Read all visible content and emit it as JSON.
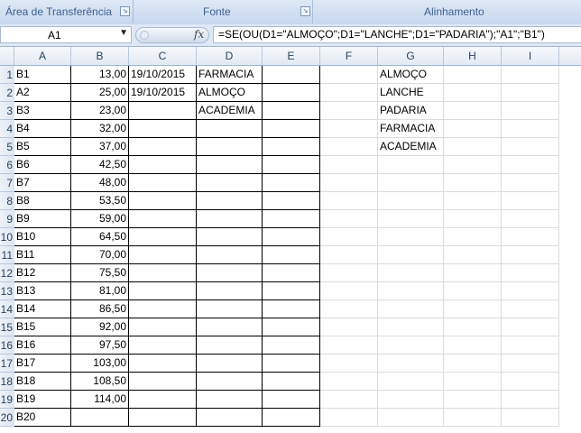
{
  "ribbon": {
    "groups": [
      {
        "label": "Área de Transferência"
      },
      {
        "label": "Fonte"
      },
      {
        "label": "Alinhamento"
      }
    ]
  },
  "formula_bar": {
    "name_box": "A1",
    "fx_icon": "function-icon",
    "formula": "=SE(OU(D1=\"ALMOÇO\";D1=\"LANCHE\";D1=\"PADARIA\");\"A1\";\"B1\")"
  },
  "columns": [
    "A",
    "B",
    "C",
    "D",
    "E",
    "F",
    "G",
    "H",
    "I"
  ],
  "rows": [
    {
      "n": "1",
      "A": "B1",
      "B": "13,00",
      "C": "19/10/2015",
      "D": "FARMACIA",
      "G": "ALMOÇO"
    },
    {
      "n": "2",
      "A": "A2",
      "B": "25,00",
      "C": "19/10/2015",
      "D": "ALMOÇO",
      "G": "LANCHE"
    },
    {
      "n": "3",
      "A": "B3",
      "B": "23,00",
      "C": "",
      "D": "ACADEMIA",
      "G": "PADARIA"
    },
    {
      "n": "4",
      "A": "B4",
      "B": "32,00",
      "C": "",
      "D": "",
      "G": "FARMACIA"
    },
    {
      "n": "5",
      "A": "B5",
      "B": "37,00",
      "C": "",
      "D": "",
      "G": "ACADEMIA"
    },
    {
      "n": "6",
      "A": "B6",
      "B": "42,50"
    },
    {
      "n": "7",
      "A": "B7",
      "B": "48,00"
    },
    {
      "n": "8",
      "A": "B8",
      "B": "53,50"
    },
    {
      "n": "9",
      "A": "B9",
      "B": "59,00"
    },
    {
      "n": "10",
      "A": "B10",
      "B": "64,50"
    },
    {
      "n": "11",
      "A": "B11",
      "B": "70,00"
    },
    {
      "n": "12",
      "A": "B12",
      "B": "75,50"
    },
    {
      "n": "13",
      "A": "B13",
      "B": "81,00"
    },
    {
      "n": "14",
      "A": "B14",
      "B": "86,50"
    },
    {
      "n": "15",
      "A": "B15",
      "B": "92,00"
    },
    {
      "n": "16",
      "A": "B16",
      "B": "97,50"
    },
    {
      "n": "17",
      "A": "B17",
      "B": "103,00"
    },
    {
      "n": "18",
      "A": "B18",
      "B": "108,50"
    },
    {
      "n": "19",
      "A": "B19",
      "B": "114,00"
    },
    {
      "n": "20",
      "A": "B20",
      "B": ""
    }
  ]
}
